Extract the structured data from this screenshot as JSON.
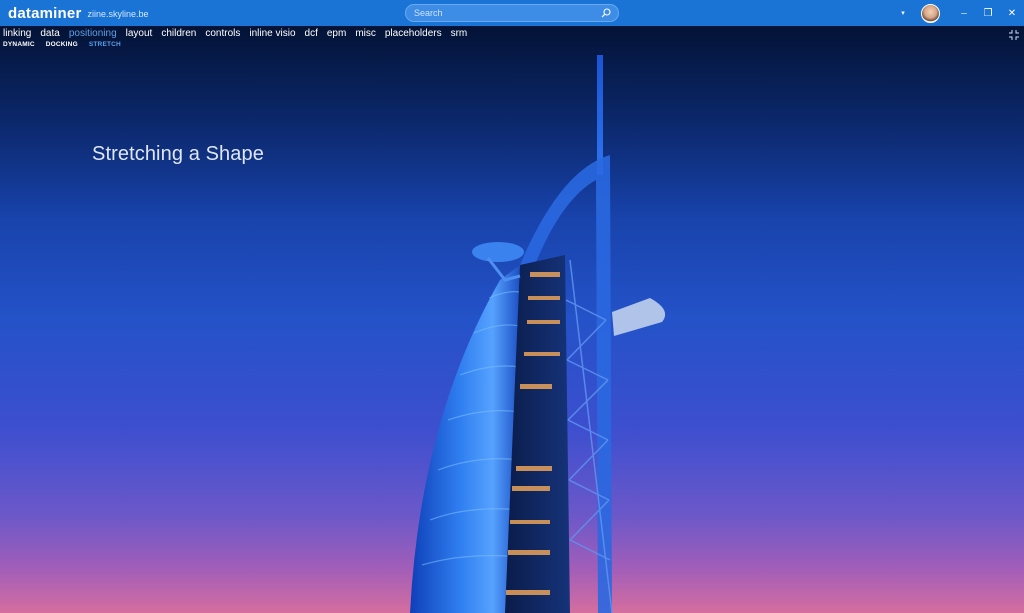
{
  "app": {
    "brand": "dataminer",
    "host": "ziine.skyline.be"
  },
  "search": {
    "placeholder": "Search",
    "value": ""
  },
  "window_controls": {
    "dropdown": "▾",
    "minimize": "─",
    "restore": "❐",
    "close": "✕"
  },
  "menu": {
    "items": [
      {
        "label": "linking"
      },
      {
        "label": "data"
      },
      {
        "label": "positioning",
        "active": true
      },
      {
        "label": "layout"
      },
      {
        "label": "children"
      },
      {
        "label": "controls"
      },
      {
        "label": "inline visio"
      },
      {
        "label": "dcf"
      },
      {
        "label": "epm"
      },
      {
        "label": "misc"
      },
      {
        "label": "placeholders"
      },
      {
        "label": "srm"
      }
    ]
  },
  "submenu": {
    "items": [
      {
        "label": "DYNAMIC"
      },
      {
        "label": "DOCKING"
      },
      {
        "label": "STRETCH",
        "active": true
      }
    ]
  },
  "main": {
    "title": "Stretching a Shape",
    "background_image": "hotel-tower-night-photo"
  },
  "colors": {
    "topbar": "#1a74d6",
    "accent": "#5aa0ec"
  }
}
